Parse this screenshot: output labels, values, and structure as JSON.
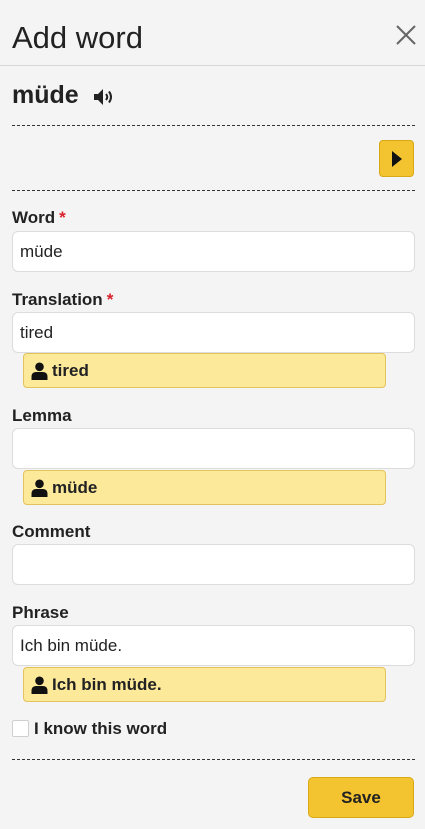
{
  "header": {
    "title": "Add word",
    "close_icon": "close-icon"
  },
  "word": {
    "text": "müde",
    "speaker_icon": "speaker-icon"
  },
  "play_icon": "play-icon",
  "required_mark": "*",
  "fields": {
    "word": {
      "label": "Word",
      "value": "müde"
    },
    "translation": {
      "label": "Translation",
      "value": "tired",
      "suggestion": "tired"
    },
    "lemma": {
      "label": "Lemma",
      "value": "",
      "suggestion": "müde"
    },
    "comment": {
      "label": "Comment",
      "value": ""
    },
    "phrase": {
      "label": "Phrase",
      "value": "Ich bin müde.",
      "suggestion": "Ich bin müde."
    }
  },
  "suggestion_icon": "user-icon",
  "checkbox": {
    "label": "I know this word",
    "checked": false
  },
  "save_label": "Save",
  "colors": {
    "accent": "#f4c430",
    "suggestion_bg": "#fde99a",
    "required": "#d9202a",
    "background": "#f4f4f4"
  }
}
